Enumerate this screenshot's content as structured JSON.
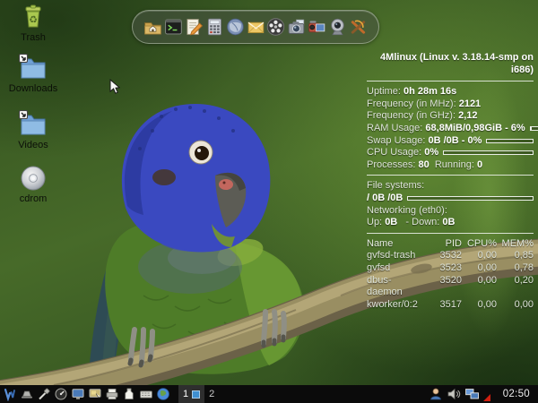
{
  "desktop": {
    "icons": [
      {
        "label": "Trash",
        "icon": "trash-icon"
      },
      {
        "label": "Downloads",
        "icon": "folder-icon"
      },
      {
        "label": "Videos",
        "icon": "folder-icon"
      },
      {
        "label": "cdrom",
        "icon": "cdrom-icon"
      }
    ]
  },
  "dock": {
    "items": [
      "file-manager",
      "terminal",
      "text-editor",
      "calculator",
      "web-browser",
      "email",
      "media-player",
      "screenshot-tool",
      "camcorder",
      "webcam",
      "games"
    ]
  },
  "system_monitor": {
    "title": "4Mlinux (Linux v. 3.18.14-smp on i686)",
    "stats": [
      {
        "label": "Uptime:",
        "value": "0h 28m 16s"
      },
      {
        "label": "Frequency (in MHz):",
        "value": "2121"
      },
      {
        "label": "Frequency (in GHz):",
        "value": "2,12"
      },
      {
        "label": "RAM Usage:",
        "value": "68,8MiB/0,98GiB - 6%",
        "bar_percent": 6
      },
      {
        "label": "Swap Usage:",
        "value": "0B /0B - 0%",
        "bar_percent": 0
      },
      {
        "label": "CPU Usage:",
        "value": "0%",
        "bar_percent": 0
      }
    ],
    "processes_label": "Processes:",
    "processes_value": "80",
    "running_label": "Running:",
    "running_value": "0",
    "filesystems_title": "File systems:",
    "filesystem_value": "/ 0B /0B",
    "filesystem_bar_percent": 0,
    "networking_title": "Networking (eth0):",
    "net_up_label": "Up:",
    "net_up_value": "0B",
    "net_down_label": "- Down:",
    "net_down_value": "0B",
    "process_table": {
      "headers": [
        "Name",
        "PID",
        "CPU%",
        "MEM%"
      ],
      "rows": [
        {
          "name": "gvfsd-trash",
          "pid": "3532",
          "cpu": "0,00",
          "mem": "0,85"
        },
        {
          "name": "gvfsd",
          "pid": "3523",
          "cpu": "0,00",
          "mem": "0,78"
        },
        {
          "name": "dbus-daemon",
          "pid": "3520",
          "cpu": "0,00",
          "mem": "0,20"
        },
        {
          "name": "kworker/0:2",
          "pid": "3517",
          "cpu": "0,00",
          "mem": "0,00"
        }
      ]
    }
  },
  "taskbar": {
    "left_icons": [
      "menu-logo",
      "laptop",
      "tool",
      "gauge",
      "display",
      "desktop-preferences",
      "printer",
      "package",
      "keyboard",
      "globe"
    ],
    "workspaces": [
      {
        "label": "1",
        "active": true
      },
      {
        "label": "2",
        "active": false
      }
    ],
    "tray_icons": [
      "user",
      "volume",
      "network",
      "alert-triangle"
    ],
    "clock": "02:50"
  },
  "colors": {
    "wallpaper_green": "#44661f",
    "taskbar_bg": "#0b0b0b",
    "pager_window_blue": "#3f8fd0",
    "parrot_head_blue": "#3a49c0",
    "parrot_body_green": "#4e7c28",
    "branch_tan": "#998e62"
  }
}
